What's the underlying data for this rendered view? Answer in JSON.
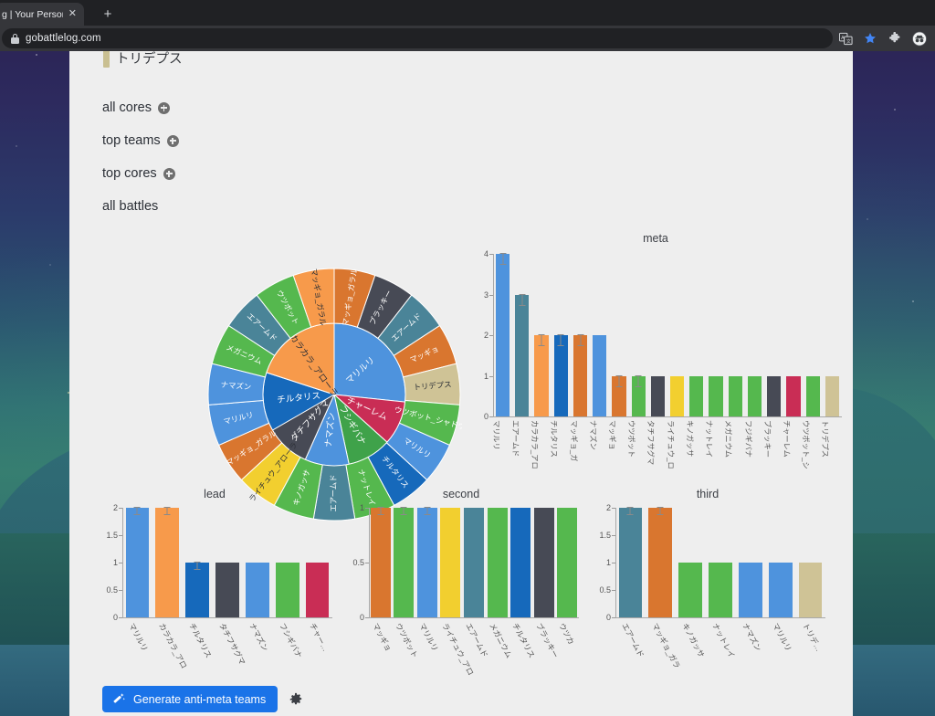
{
  "browser": {
    "tab": {
      "title": "g | Your Personal Ba",
      "close_label": "✕"
    },
    "new_tab_label": "+",
    "url": "gobattlelog.com",
    "icons": [
      {
        "name": "translate-icon",
        "label": "translate"
      },
      {
        "name": "bookmark-star-icon",
        "label": "bookmark"
      },
      {
        "name": "extensions-puzzle-icon",
        "label": "extensions"
      },
      {
        "name": "incognito-profile-icon",
        "label": "profile"
      }
    ]
  },
  "page": {
    "partial_heading": "トリデプス",
    "nav": [
      {
        "label": "all cores",
        "has_plus": true
      },
      {
        "label": "top teams",
        "has_plus": true
      },
      {
        "label": "top cores",
        "has_plus": true
      },
      {
        "label": "all battles",
        "has_plus": false
      }
    ],
    "generate_button": "Generate anti-meta teams",
    "settings_tooltip": "settings"
  },
  "colors": {
    "blue_light": "#4e93dd",
    "blue_dark": "#1669bb",
    "teal": "#4a8498",
    "orange_light": "#f79a4b",
    "orange_dark": "#d9762f",
    "green": "#55b84e",
    "green_dark": "#3fa24a",
    "yellow": "#f2cf2f",
    "charcoal": "#474a55",
    "crimson": "#c92d55",
    "tan": "#cfc396",
    "accent": "#1a73e8",
    "page_bg": "#eeeeee"
  },
  "chart_data": [
    {
      "type": "pie",
      "name": "sunburst",
      "title": "",
      "inner_ring": [
        {
          "label": "マリルリ",
          "value": 4,
          "color": "#4e93dd"
        },
        {
          "label": "チャーレム",
          "value": 1.5,
          "color": "#c92d55"
        },
        {
          "label": "フシギバナ",
          "value": 1.5,
          "color": "#3fa24a"
        },
        {
          "label": "ナマズン",
          "value": 1.5,
          "color": "#4e93dd"
        },
        {
          "label": "ダチフサグマ",
          "value": 1.5,
          "color": "#474a55"
        },
        {
          "label": "チルタリス",
          "value": 2,
          "color": "#1669bb"
        },
        {
          "label": "カラカラ_アローラ",
          "value": 3,
          "color": "#f79a4b"
        }
      ],
      "outer_ring": [
        {
          "label": "マッギョ_ガラル",
          "color": "#d9762f"
        },
        {
          "label": "ブラッキー",
          "color": "#474a55"
        },
        {
          "label": "エアームド",
          "color": "#4a8498"
        },
        {
          "label": "マッギョ",
          "color": "#d9762f"
        },
        {
          "label": "トリデプス",
          "color": "#cfc396"
        },
        {
          "label": "ウツボット_シャドウ",
          "color": "#55b84e"
        },
        {
          "label": "マリルリ",
          "color": "#4e93dd"
        },
        {
          "label": "チルタリス",
          "color": "#1669bb"
        },
        {
          "label": "ナットレイ",
          "color": "#55b84e"
        },
        {
          "label": "エアームド",
          "color": "#4a8498"
        },
        {
          "label": "キノガッサ",
          "color": "#55b84e"
        },
        {
          "label": "ライチュウ_アローラ",
          "color": "#f2cf2f"
        },
        {
          "label": "マッギョ_ガラル",
          "color": "#d9762f"
        },
        {
          "label": "マリルリ",
          "color": "#4e93dd"
        },
        {
          "label": "ナマズン",
          "color": "#4e93dd"
        },
        {
          "label": "メガニウム",
          "color": "#55b84e"
        },
        {
          "label": "エアームド",
          "color": "#4a8498"
        },
        {
          "label": "ウツボット",
          "color": "#55b84e"
        },
        {
          "label": "マッギョ_ガラル",
          "color": "#f79a4b"
        }
      ]
    },
    {
      "type": "bar",
      "name": "meta",
      "title": "meta",
      "ylim": [
        0,
        4
      ],
      "yticks": [
        0,
        1,
        2,
        3,
        4
      ],
      "categories": [
        "マリルリ",
        "エアームド",
        "カラカラ_アロ",
        "チルタリス",
        "マッギョ_ガ",
        "ナマズン",
        "マッギョ",
        "ウツボット",
        "タチフサグマ",
        "ライチュウ_ロ",
        "キノガッサ",
        "ナットレイ",
        "メガニウム",
        "フジギバナ",
        "ブラッキー",
        "チャーレム",
        "ウツボット_シ",
        "トリデプス"
      ],
      "values": [
        4,
        3,
        2,
        2,
        2,
        2,
        1,
        1,
        1,
        1,
        1,
        1,
        1,
        1,
        1,
        1,
        1,
        1
      ],
      "colors": [
        "#4e93dd",
        "#4a8498",
        "#f79a4b",
        "#1669bb",
        "#d9762f",
        "#4e93dd",
        "#d9762f",
        "#55b84e",
        "#474a55",
        "#f2cf2f",
        "#55b84e",
        "#55b84e",
        "#55b84e",
        "#55b84e",
        "#474a55",
        "#c92d55",
        "#55b84e",
        "#cfc396"
      ],
      "errorbars": [
        true,
        true,
        true,
        true,
        true,
        false,
        true,
        true,
        false,
        false,
        false,
        false,
        false,
        false,
        false,
        false,
        false,
        false
      ]
    },
    {
      "type": "bar",
      "name": "lead",
      "title": "lead",
      "ylim": [
        0,
        2
      ],
      "yticks": [
        0,
        0.5,
        1,
        1.5,
        2
      ],
      "categories": [
        "マリルリ",
        "カラカラ_アロ",
        "チルタリス",
        "タチフサグマ",
        "ナマズン",
        "フシギバナ",
        "チャー…"
      ],
      "values": [
        2,
        2,
        1,
        1,
        1,
        1,
        1
      ],
      "colors": [
        "#4e93dd",
        "#f79a4b",
        "#1669bb",
        "#474a55",
        "#4e93dd",
        "#55b84e",
        "#c92d55"
      ],
      "errorbars": [
        true,
        true,
        true,
        false,
        false,
        false,
        false
      ]
    },
    {
      "type": "bar",
      "name": "second",
      "title": "second",
      "ylim": [
        0,
        1
      ],
      "yticks": [
        0,
        0.5,
        1
      ],
      "categories": [
        "マッギョ",
        "ウツボット",
        "マリルリ",
        "ライチュウ_アロ",
        "エアームド",
        "メガニウム",
        "チルタリス",
        "ブラッキー",
        "ウツカ"
      ],
      "values": [
        1,
        1,
        1,
        1,
        1,
        1,
        1,
        1,
        1
      ],
      "colors": [
        "#d9762f",
        "#55b84e",
        "#4e93dd",
        "#f2cf2f",
        "#4a8498",
        "#55b84e",
        "#1669bb",
        "#474a55",
        "#55b84e"
      ],
      "errorbars": [
        true,
        true,
        true,
        false,
        false,
        false,
        false,
        false,
        false
      ]
    },
    {
      "type": "bar",
      "name": "third",
      "title": "third",
      "ylim": [
        0,
        2
      ],
      "yticks": [
        0,
        0.5,
        1,
        1.5,
        2
      ],
      "categories": [
        "エアームド",
        "マッギョ_ガラ",
        "キノガッサ",
        "ナットレイ",
        "ナマズン",
        "マリルリ",
        "トリデ…"
      ],
      "values": [
        2,
        2,
        1,
        1,
        1,
        1,
        1
      ],
      "colors": [
        "#4a8498",
        "#d9762f",
        "#55b84e",
        "#55b84e",
        "#4e93dd",
        "#4e93dd",
        "#cfc396"
      ],
      "errorbars": [
        true,
        true,
        false,
        false,
        false,
        false,
        false
      ]
    }
  ]
}
